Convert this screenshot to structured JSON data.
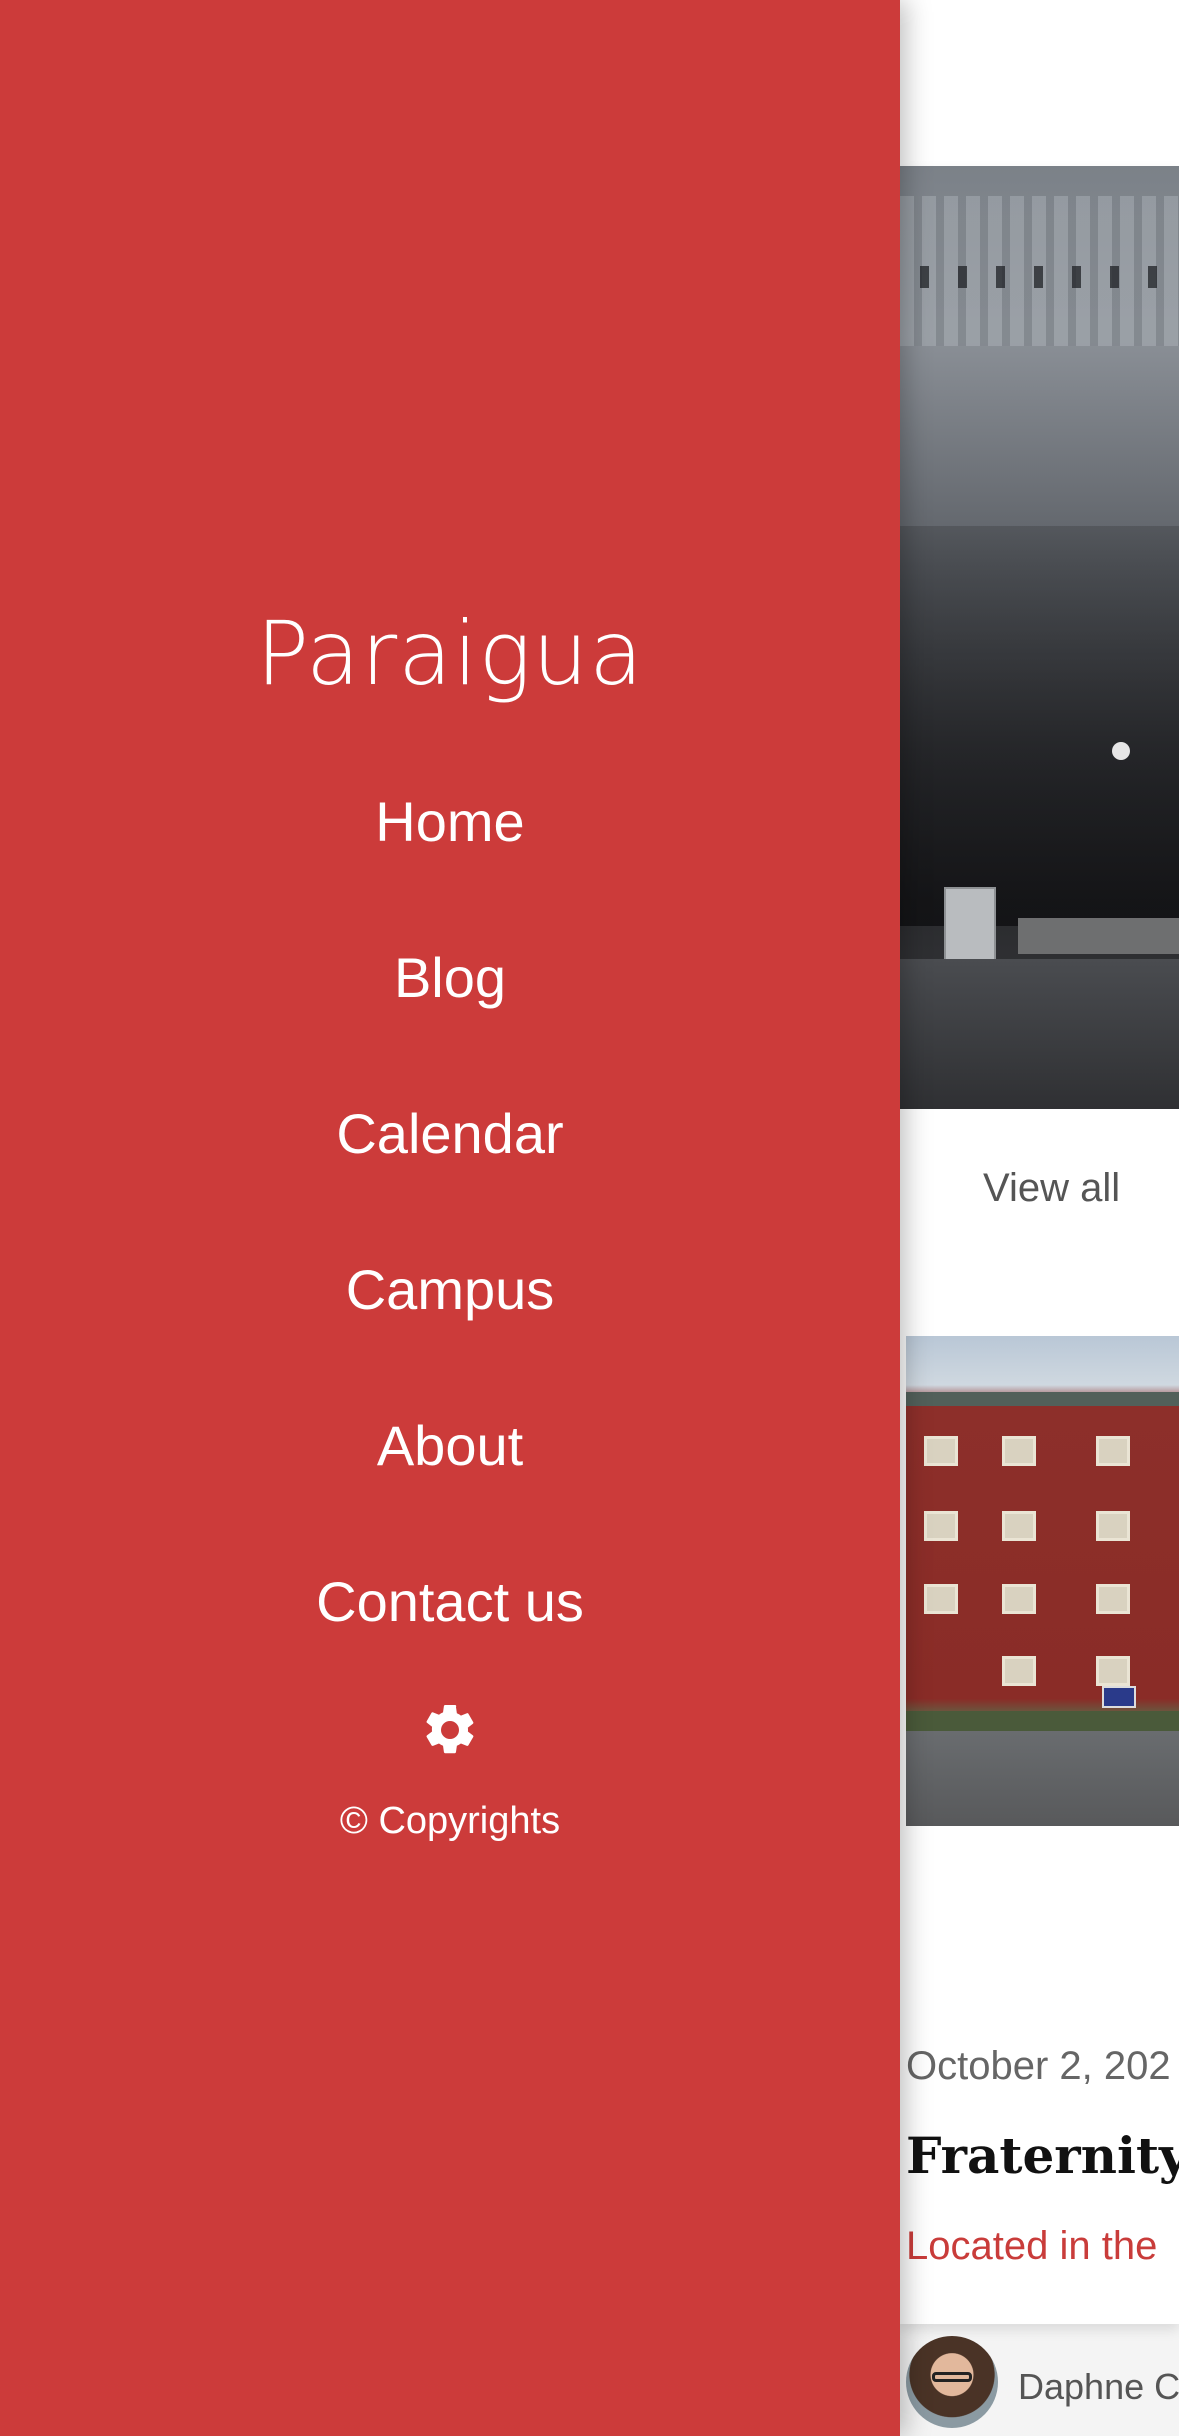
{
  "drawer": {
    "brand": "Paraigua",
    "nav": [
      {
        "label": "Home"
      },
      {
        "label": "Blog"
      },
      {
        "label": "Calendar"
      },
      {
        "label": "Campus"
      },
      {
        "label": "About"
      },
      {
        "label": "Contact us"
      }
    ],
    "settings_icon": "gear-icon",
    "copyright": "© Copyrights",
    "background_color": "#cc3b3a"
  },
  "content": {
    "view_all_label": "View all",
    "post": {
      "date": "October 2, 202",
      "title": "Fraternity I",
      "excerpt": "Located in the",
      "author_name": "Daphne C"
    },
    "accent_color": "#c93c3a"
  }
}
